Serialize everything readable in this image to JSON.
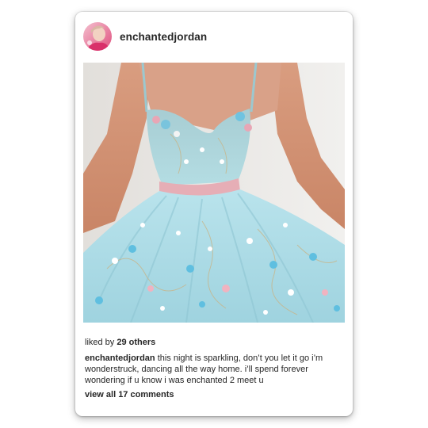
{
  "post": {
    "username": "enchantedjordan",
    "avatar_icon": "profile-avatar",
    "likes_prefix": "liked by",
    "likes_count": "29 others",
    "caption_user": "enchantedjordan",
    "caption_text": "this night is sparkling, don’t you let it go i’m wonderstruck, dancing all the way home. i’ll spend forever wondering if u know i was enchanted 2 meet u",
    "comments_link": "view all 17 comments",
    "photo_subject": "light blue floral embroidered tulle dress with pink waistband"
  },
  "colors": {
    "card_bg": "#ffffff",
    "text": "#262626",
    "dress_blue": "#a9dbe6",
    "waistband_pink": "#e6aeb6",
    "wall": "#e9e8e6"
  }
}
